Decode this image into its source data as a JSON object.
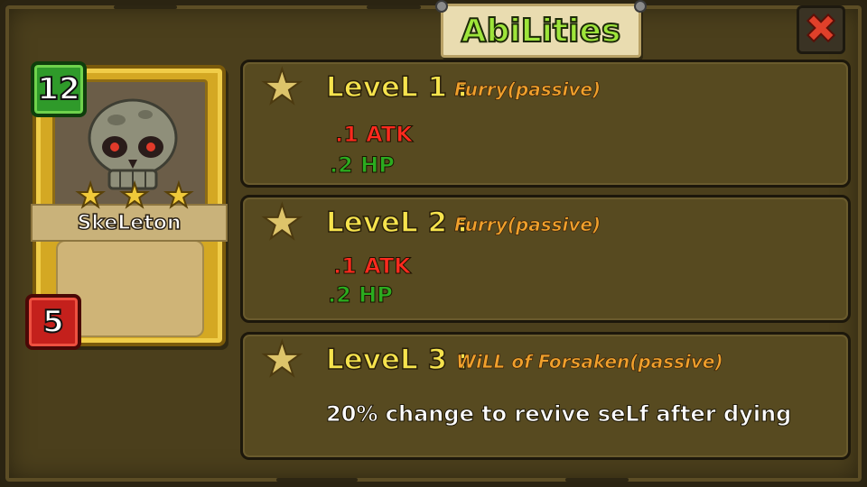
{
  "header": {
    "title": "AbiLities",
    "close_icon": "close-x-icon"
  },
  "unit_card": {
    "name": "SkeLeton",
    "level_badge": "12",
    "cost_badge": "5",
    "stars": 3,
    "portrait_icon": "skull-icon",
    "colors": {
      "level_badge": "#2f9a2a",
      "cost_badge": "#c4201c",
      "frame": "#d4a823"
    }
  },
  "abilities": [
    {
      "level_label": "LeveL 1 :",
      "name": "Furry(passive)",
      "atk": ".1 ATK",
      "hp": ".2 HP"
    },
    {
      "level_label": "LeveL 2 :",
      "name": "Furry(passive)",
      "atk": ".1 ATK",
      "hp": ".2 HP"
    },
    {
      "level_label": "LeveL 3 :",
      "name": "WiLL of Forsaken(passive)",
      "description": "20% change to revive seLf after dying"
    }
  ],
  "colors": {
    "title": "#9ee53a",
    "level_label": "#f6e34d",
    "ability_name": "#f0a02c",
    "atk": "#ff2a1e",
    "hp": "#2bab1f"
  }
}
